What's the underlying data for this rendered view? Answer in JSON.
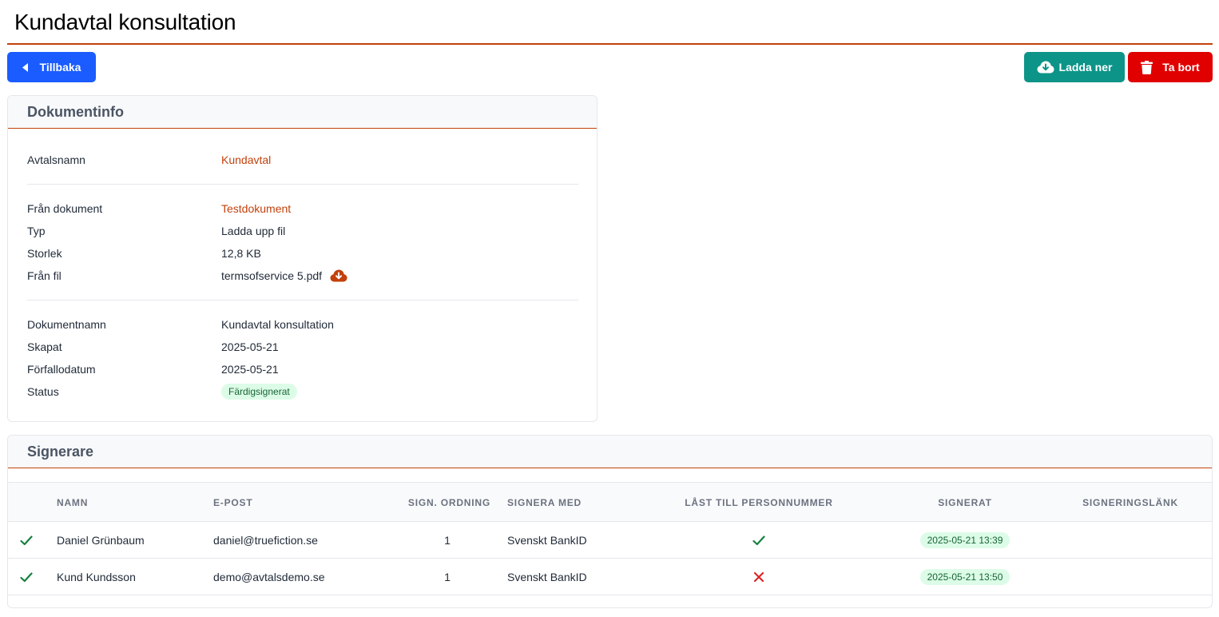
{
  "page": {
    "title": "Kundavtal konsultation"
  },
  "toolbar": {
    "back_label": "Tillbaka",
    "download_label": "Ladda ner",
    "delete_label": "Ta bort"
  },
  "colors": {
    "accent": "#c2410c",
    "primary": "#1a5cff",
    "download": "#0d9488",
    "danger": "#e00000",
    "success": "#15803d",
    "error": "#dc2626"
  },
  "document_info": {
    "header": "Dokumentinfo",
    "agreement_name_label": "Avtalsnamn",
    "agreement_name_value": "Kundavtal",
    "from_document_label": "Från dokument",
    "from_document_value": "Testdokument",
    "type_label": "Typ",
    "type_value": "Ladda upp fil",
    "size_label": "Storlek",
    "size_value": "12,8 KB",
    "from_file_label": "Från fil",
    "from_file_value": "termsofservice 5.pdf",
    "document_name_label": "Dokumentnamn",
    "document_name_value": "Kundavtal konsultation",
    "created_label": "Skapat",
    "created_value": "2025-05-21",
    "due_date_label": "Förfallodatum",
    "due_date_value": "2025-05-21",
    "status_label": "Status",
    "status_value": "Färdigsignerat"
  },
  "signers": {
    "header": "Signerare",
    "columns": {
      "name": "NAMN",
      "email": "E-POST",
      "order": "SIGN. ORDNING",
      "sign_with": "SIGNERA MED",
      "locked": "LÅST TILL PERSONNUMMER",
      "signed": "SIGNERAT",
      "link": "SIGNERINGSLÄNK"
    },
    "rows": [
      {
        "status_icon": "check-icon",
        "name": "Daniel Grünbaum",
        "email": "daniel@truefiction.se",
        "order": "1",
        "sign_with": "Svenskt BankID",
        "locked_icon": "check-icon",
        "signed": "2025-05-21 13:39"
      },
      {
        "status_icon": "check-icon",
        "name": "Kund Kundsson",
        "email": "demo@avtalsdemo.se",
        "order": "1",
        "sign_with": "Svenskt BankID",
        "locked_icon": "cross-icon",
        "signed": "2025-05-21 13:50"
      }
    ]
  }
}
